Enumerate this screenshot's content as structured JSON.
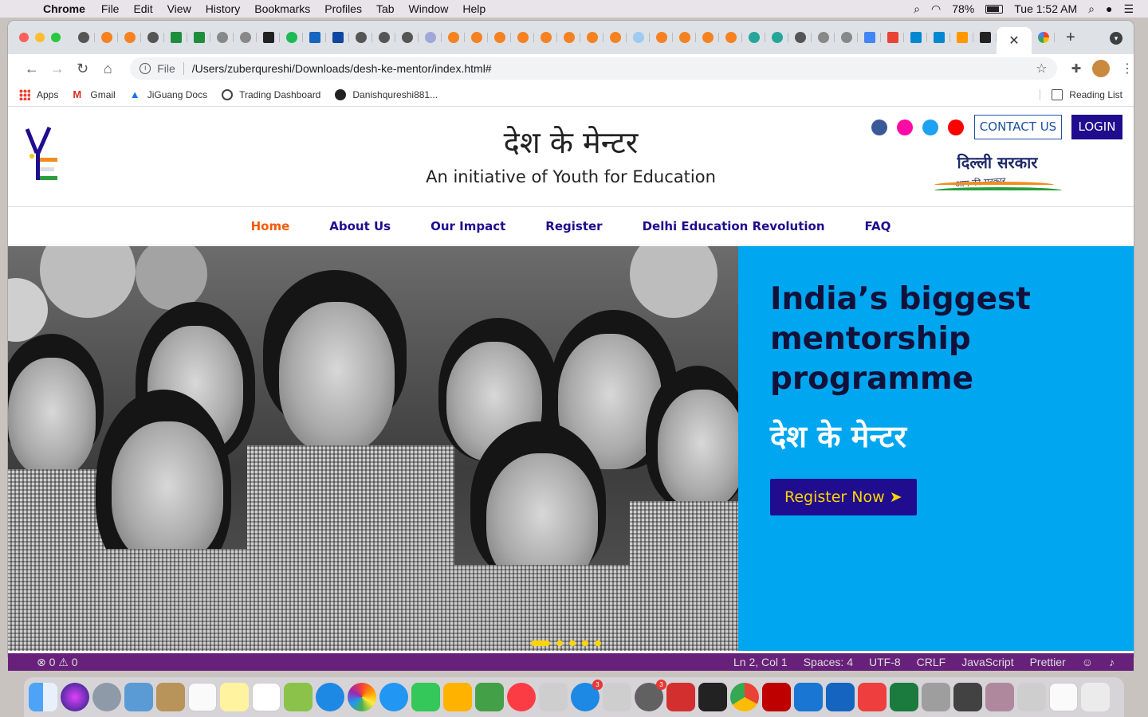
{
  "menubar": {
    "app_name": "Chrome",
    "items": [
      "File",
      "Edit",
      "View",
      "History",
      "Bookmarks",
      "Profiles",
      "Tab",
      "Window",
      "Help"
    ],
    "battery": "78%",
    "clock": "Tue 1:52 AM"
  },
  "browser": {
    "url_scheme": "File",
    "url": "/Users/zuberqureshi/Downloads/desh-ke-mentor/index.html#",
    "bookmarks": [
      "Apps",
      "Gmail",
      "JiGuang Docs",
      "Trading Dashboard",
      "Danishqureshi881..."
    ],
    "reading_list": "Reading List"
  },
  "site": {
    "title": "देश के मेन्टर",
    "subtitle": "An initiative of Youth for Education",
    "contact_label": "CONTACT US",
    "login_label": "LOGIN",
    "delhi_logo": {
      "line1": "दिल्ली सरकार",
      "line2": "आप की सरकार"
    },
    "social_colors": [
      "#3b5998",
      "#ff0aa5",
      "#1da1f2",
      "#ff0000"
    ],
    "nav": [
      "Home",
      "About Us",
      "Our Impact",
      "Register",
      "Delhi Education Revolution",
      "FAQ"
    ],
    "hero": {
      "heading": "India’s biggest mentorship programme",
      "hindi": "देश के मेन्टर",
      "cta": "Register Now ➤"
    },
    "slider_dots": 5
  },
  "statusbar": {
    "problems": "⊗ 0 ⚠ 0",
    "position": "Ln 2, Col 1",
    "spaces": "Spaces: 4",
    "encoding": "UTF-8",
    "eol": "CRLF",
    "language": "JavaScript",
    "formatter": "Prettier"
  },
  "colors": {
    "brand_navy": "#1f0c8e",
    "hero_blue": "#00a6f0",
    "nav_active": "#f25c05",
    "cta_text": "#ffd400"
  }
}
